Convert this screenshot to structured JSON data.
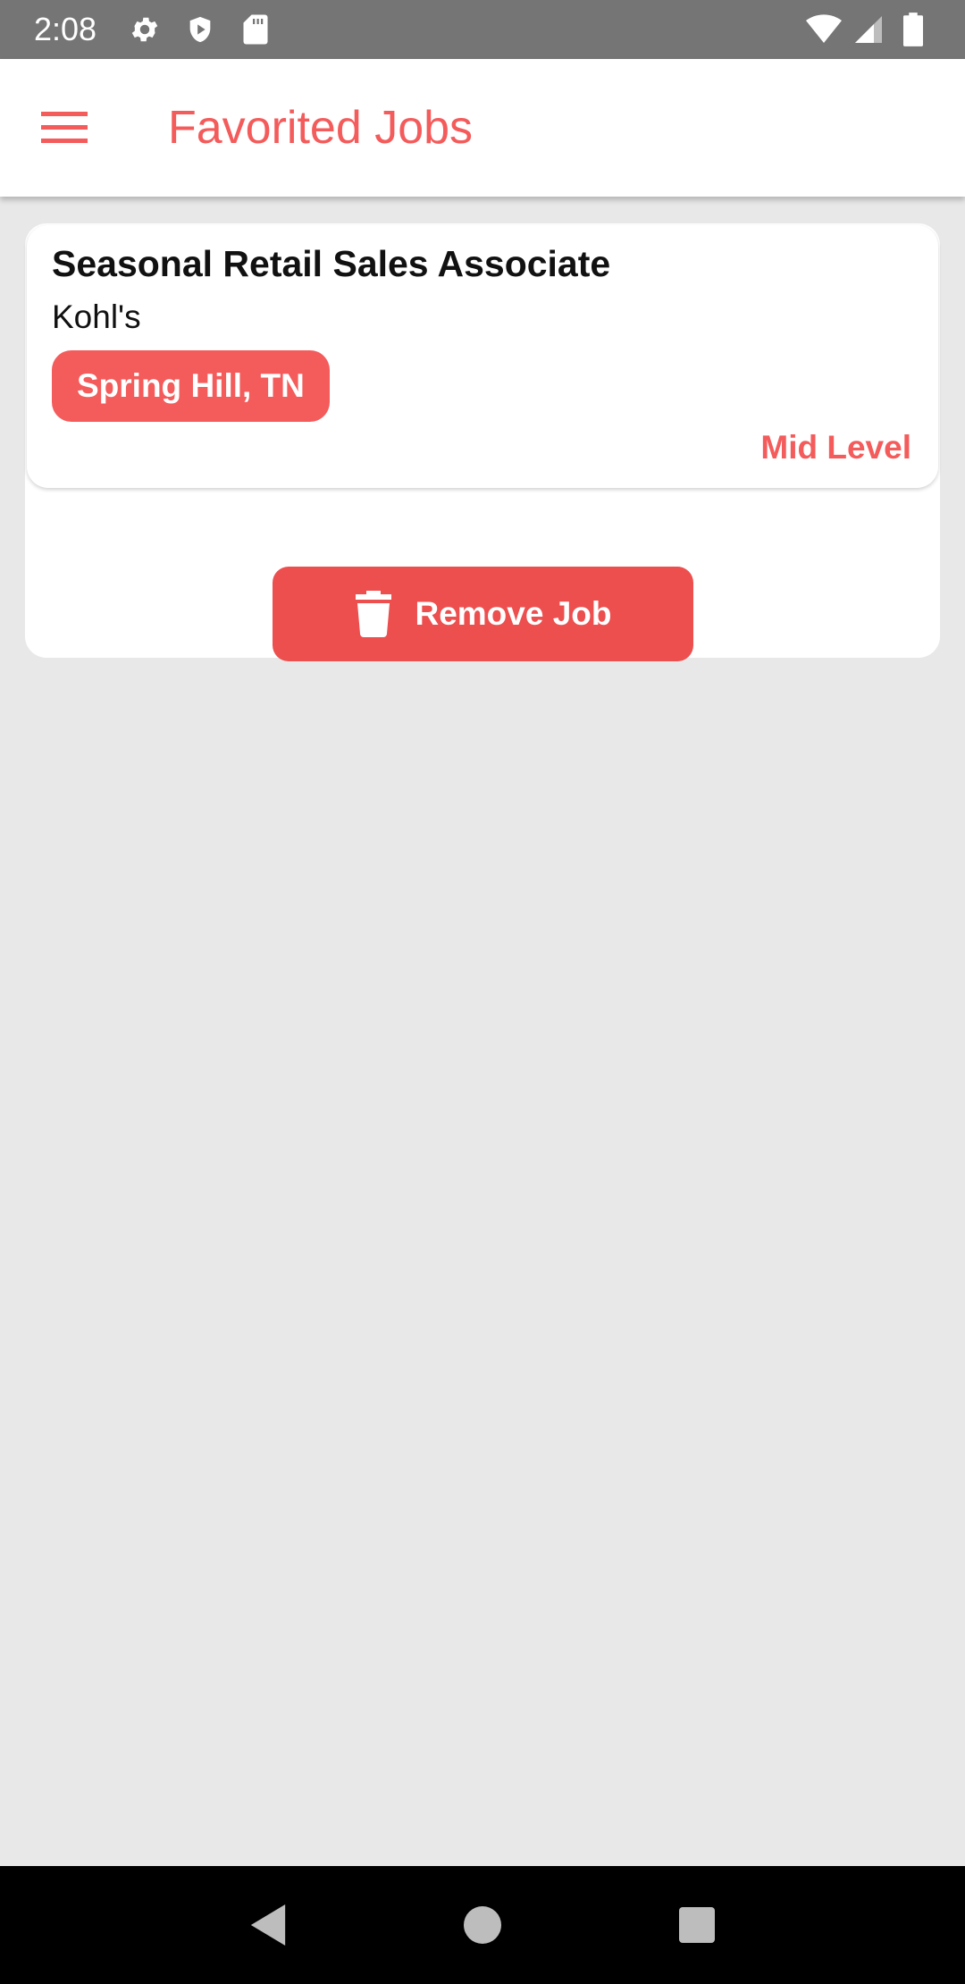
{
  "status_bar": {
    "time": "2:08",
    "icons_left": [
      "gear-icon",
      "shield-play-icon",
      "sd-card-icon"
    ],
    "icons_right": [
      "wifi-icon",
      "cell-signal-icon",
      "battery-icon"
    ]
  },
  "app_bar": {
    "title": "Favorited Jobs",
    "menu_icon": "hamburger-menu-icon"
  },
  "jobs": [
    {
      "title": "Seasonal Retail Sales Associate",
      "company": "Kohl's",
      "location": "Spring Hill, TN",
      "level": "Mid Level",
      "remove_label": "Remove Job"
    }
  ],
  "nav_bar": {
    "buttons": [
      "back-icon",
      "home-icon",
      "recents-icon"
    ]
  },
  "colors": {
    "accent": "#f45b5b",
    "button": "#ed4e4e",
    "status_bar": "#757575",
    "background": "#e8e8e8"
  }
}
